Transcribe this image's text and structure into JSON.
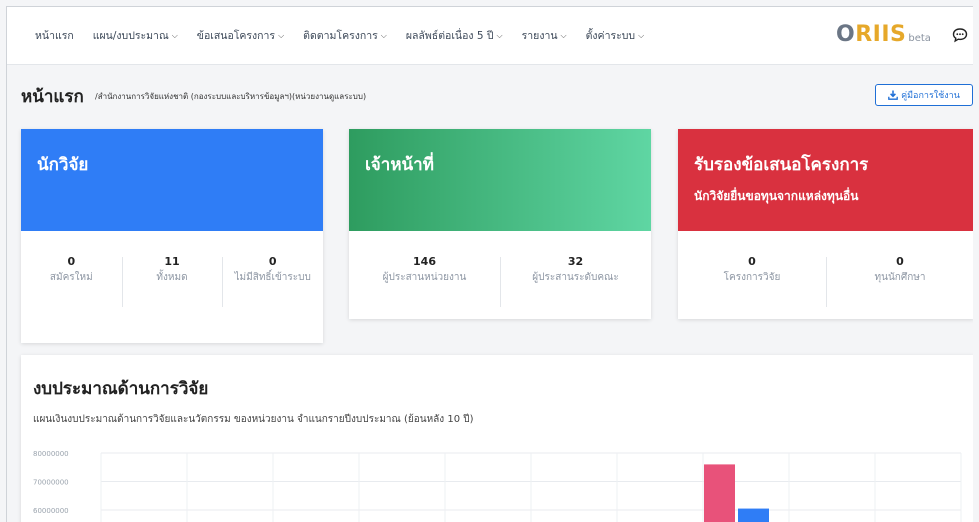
{
  "nav": {
    "items": [
      {
        "label": "หน้าแรก",
        "has_dropdown": false
      },
      {
        "label": "แผน/งบประมาณ",
        "has_dropdown": true
      },
      {
        "label": "ข้อเสนอโครงการ",
        "has_dropdown": true
      },
      {
        "label": "ติดตามโครงการ",
        "has_dropdown": true
      },
      {
        "label": "ผลลัพธ์ต่อเนื่อง 5 ปี",
        "has_dropdown": true
      },
      {
        "label": "รายงาน",
        "has_dropdown": true
      },
      {
        "label": "ตั้งค่าระบบ",
        "has_dropdown": true
      }
    ],
    "brand_o": "O",
    "brand_rest": "RIIS",
    "brand_beta": "beta",
    "chat_icon": "chat-icon"
  },
  "page": {
    "title": "หน้าแรก",
    "breadcrumb": "/สำนักงานการวิจัยแห่งชาติ (กองระบบและบริหารข้อมูลฯ)(หน่วยงานดูแลระบบ)",
    "manual_button": "คู่มือการใช้งาน"
  },
  "cards": {
    "researcher": {
      "title": "นักวิจัย",
      "stats": [
        {
          "value": "0",
          "label": "สมัครใหม่"
        },
        {
          "value": "11",
          "label": "ทั้งหมด"
        },
        {
          "value": "0",
          "label": "ไม่มีสิทธิ์เข้าระบบ"
        }
      ]
    },
    "staff": {
      "title": "เจ้าหน้าที่",
      "stats": [
        {
          "value": "146",
          "label": "ผู้ประสานหน่วยงาน"
        },
        {
          "value": "32",
          "label": "ผู้ประสานระดับคณะ"
        }
      ]
    },
    "proposal": {
      "title": "รับรองข้อเสนอโครงการ",
      "subtitle": "นักวิจัยยื่นขอทุนจากแหล่งทุนอื่น",
      "stats": [
        {
          "value": "0",
          "label": "โครงการวิจัย"
        },
        {
          "value": "0",
          "label": "ทุนนักศึกษา"
        }
      ]
    }
  },
  "budget": {
    "title": "งบประมาณด้านการวิจัย",
    "subtitle": "แผนเงินงบประมาณด้านการวิจัยและนวัตกรรม ของหน่วยงาน จำแนกรายปีงบประมาณ (ย้อนหลัง 10 ปี)"
  },
  "colors": {
    "researcher": "#2f7df6",
    "staff_from": "#2e9c5f",
    "staff_to": "#5fd6a3",
    "proposal": "#d9313f",
    "series_a": "#e8527a",
    "series_b": "#2f7df6"
  },
  "chart_data": {
    "type": "bar",
    "ylim": [
      50000000,
      80000000
    ],
    "yticks": [
      "80000000",
      "70000000",
      "60000000"
    ],
    "series": [
      {
        "values": [
          null,
          null,
          null,
          null,
          null,
          null,
          null,
          76000000,
          null,
          null
        ]
      },
      {
        "values": [
          null,
          null,
          null,
          null,
          null,
          null,
          null,
          60500000,
          null,
          null
        ]
      }
    ]
  }
}
